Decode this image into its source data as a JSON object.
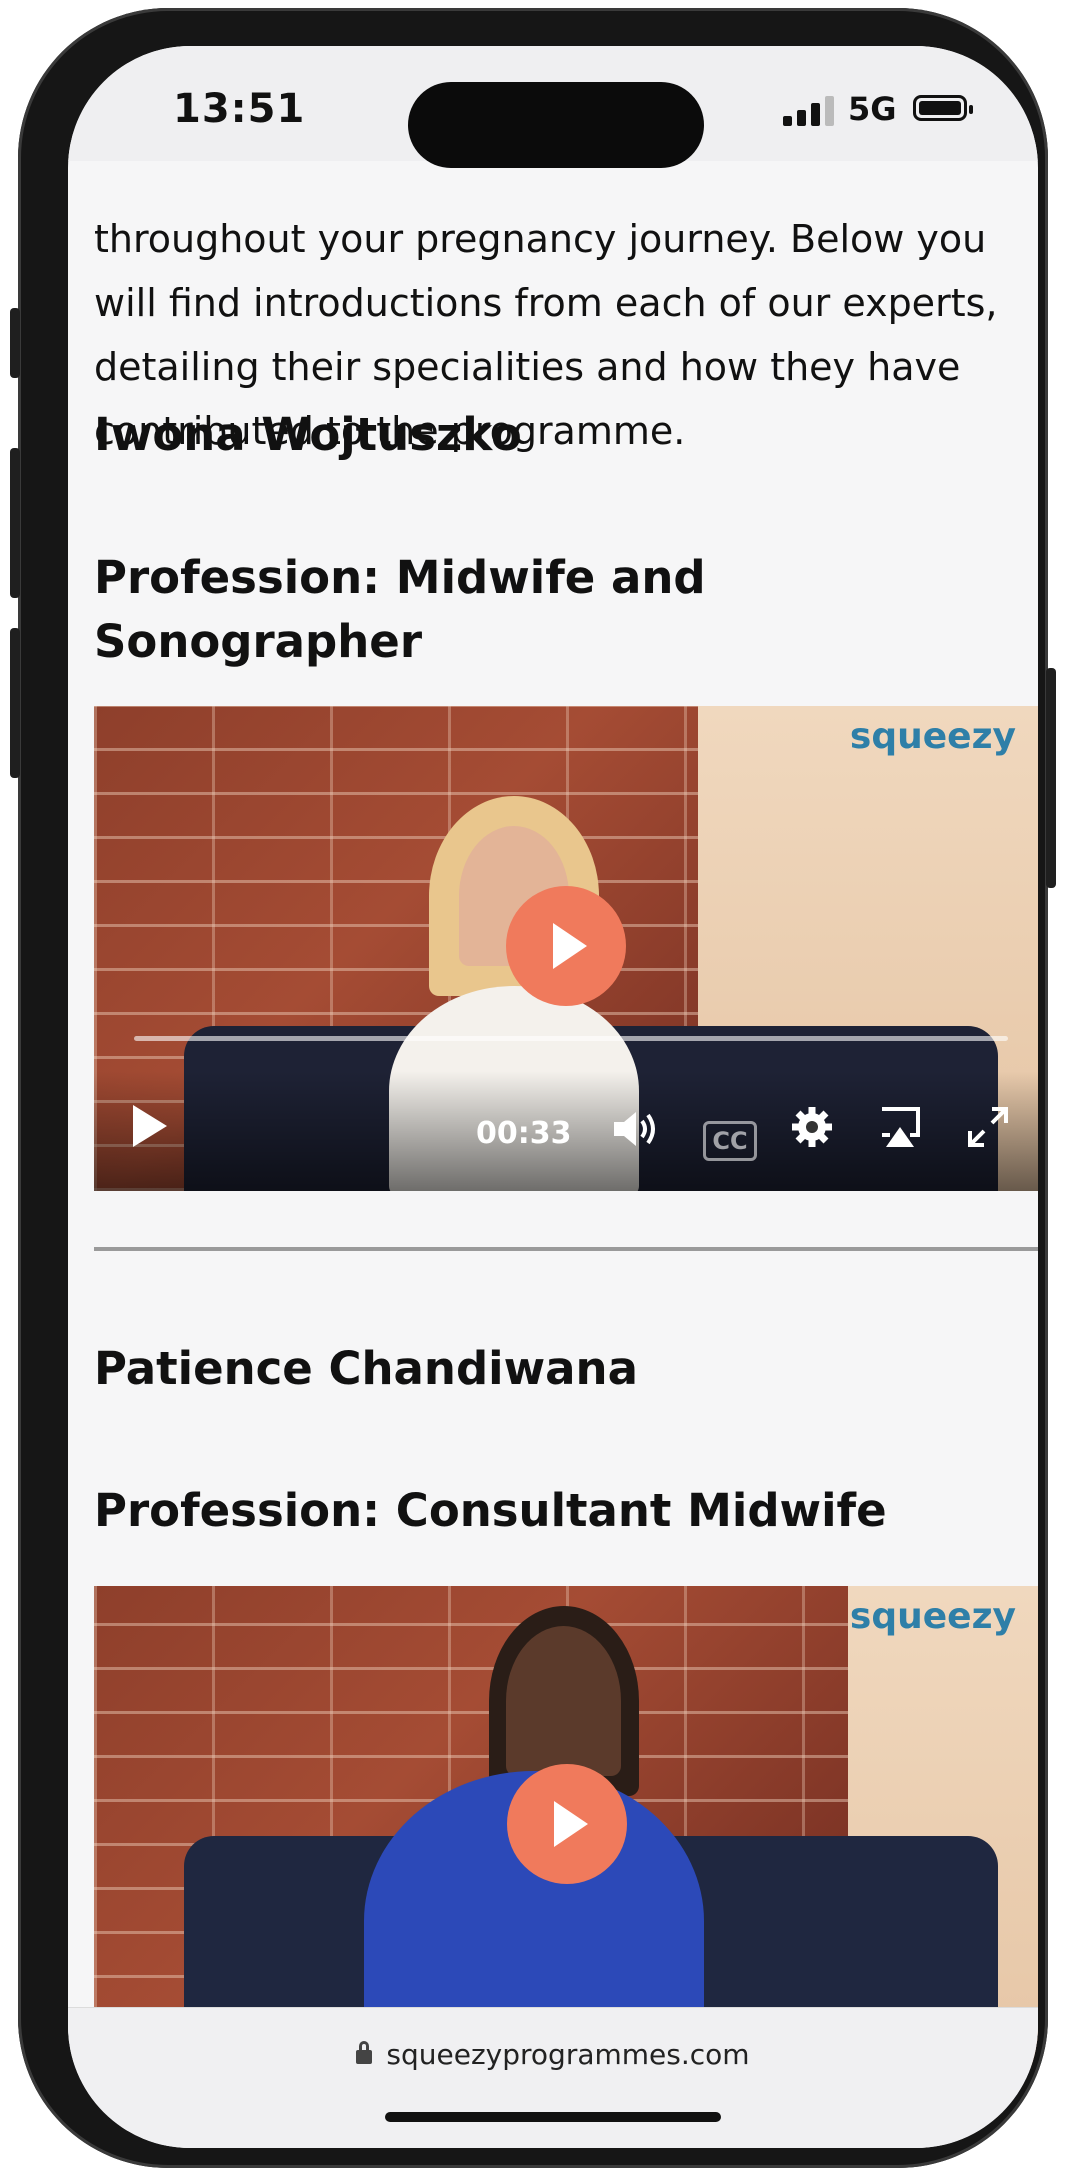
{
  "status": {
    "time": "13:51",
    "network": "5G"
  },
  "intro_text": "throughout your pregnancy journey. Below you will find introductions from each of our experts, detailing their specialities and how they have contributed to the programme.",
  "experts": [
    {
      "name": "Iwona Wojtuszko",
      "profession": "Profession: Midwife and Sonographer",
      "video": {
        "logo": "squeezy",
        "time": "00:33",
        "cc": "CC"
      }
    },
    {
      "name": "Patience Chandiwana",
      "profession": "Profession: Consultant Midwife",
      "video": {
        "logo": "squeezy"
      }
    }
  ],
  "browser": {
    "url": "squeezyprogrammes.com"
  },
  "colors": {
    "play_button": "#f07a5c",
    "logo": "#2e7fa8",
    "frame": "#161616"
  },
  "icons": {
    "play": "play-icon",
    "volume": "volume-icon",
    "captions": "closed-captions-icon",
    "settings": "gear-icon",
    "airplay": "airplay-icon",
    "fullscreen": "fullscreen-icon",
    "lock": "lock-icon"
  }
}
